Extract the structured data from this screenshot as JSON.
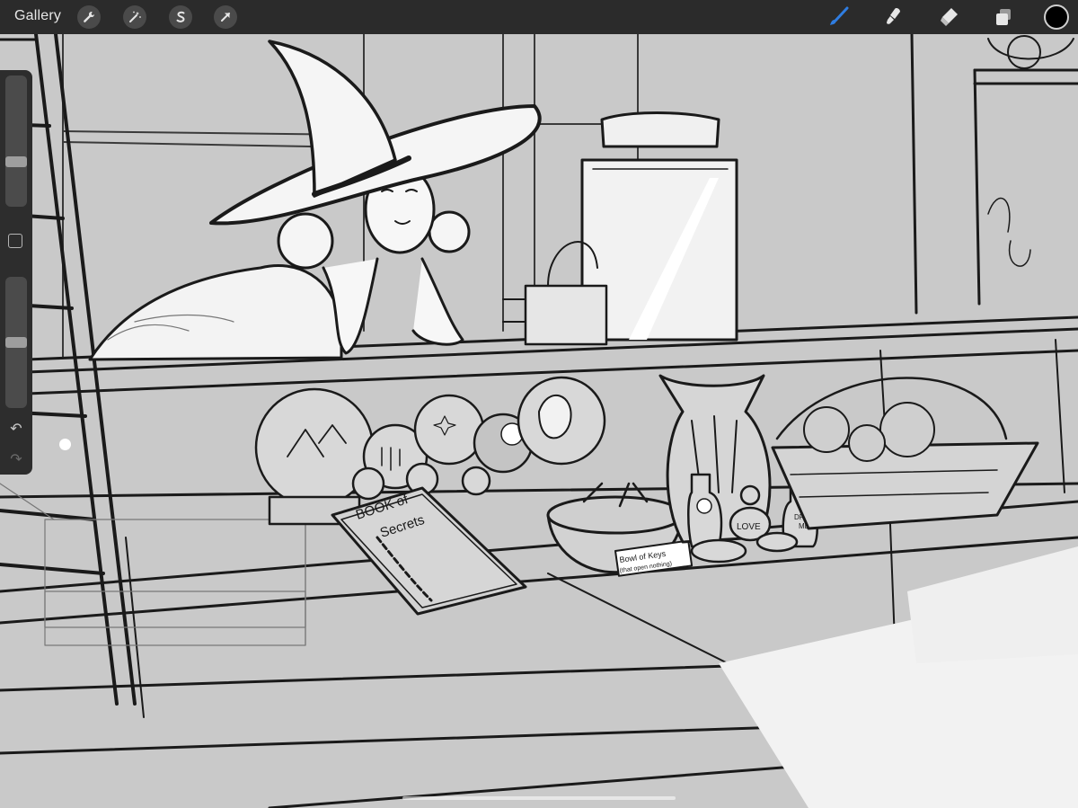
{
  "toolbar": {
    "gallery_label": "Gallery",
    "left_tools": [
      {
        "name": "actions-wrench-icon"
      },
      {
        "name": "adjustments-wand-icon"
      },
      {
        "name": "selection-s-icon"
      },
      {
        "name": "transform-arrow-icon"
      }
    ],
    "right_tools": [
      {
        "name": "brush-icon",
        "active": true,
        "color": "#2f7de1"
      },
      {
        "name": "smudge-icon",
        "active": false
      },
      {
        "name": "eraser-icon",
        "active": false
      },
      {
        "name": "layers-icon",
        "active": false
      }
    ],
    "current_color": "#000000"
  },
  "sidebar": {
    "brush_size_level": 0.25,
    "brush_opacity_level": 0.5
  },
  "artwork": {
    "book_title_line1": "BOOK of",
    "book_title_line2": "Secrets",
    "bowl_sign_line1": "Bowl of Keys",
    "bowl_sign_line2": "(that open nothing)",
    "love_label": "LOVE",
    "drink_label_line1": "DRINK",
    "drink_label_line2": "ME"
  },
  "colors": {
    "toolbar_bg": "#2b2b2b",
    "canvas_bg": "#c9c9c9",
    "accent": "#2f7de1"
  }
}
